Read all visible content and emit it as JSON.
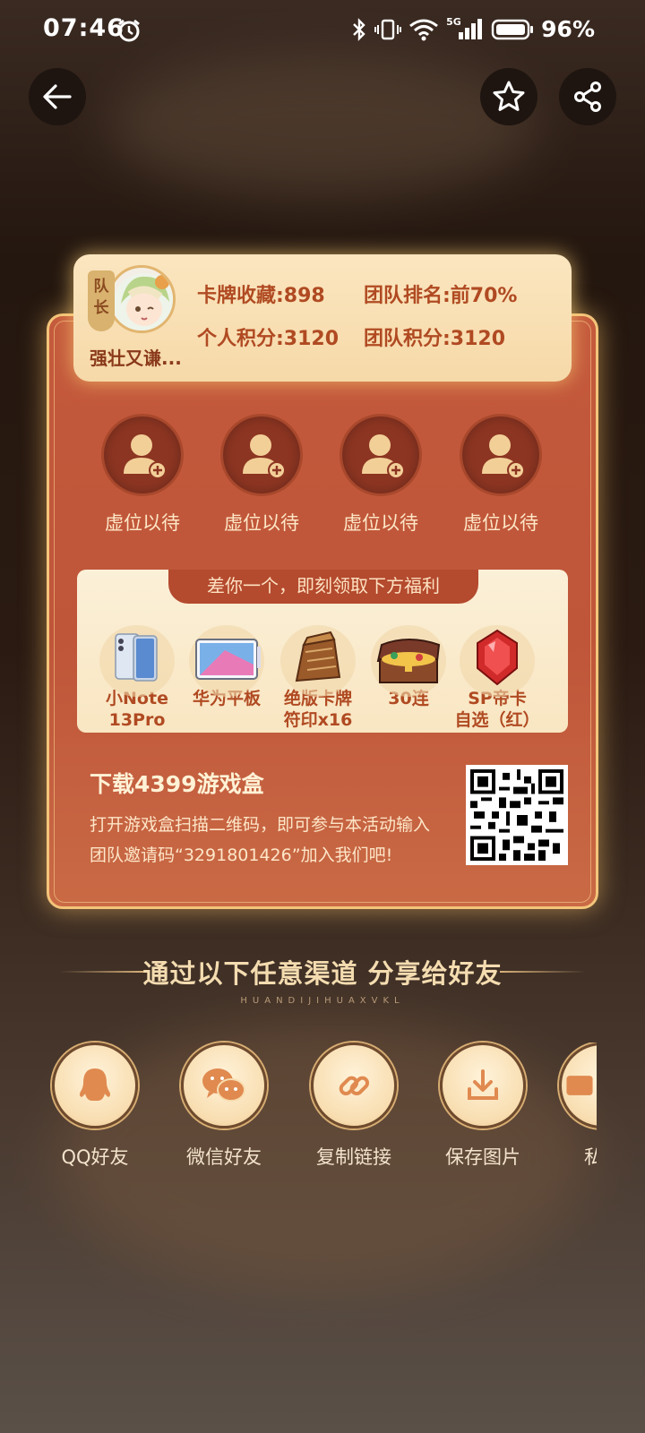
{
  "status_bar": {
    "time": "07:46",
    "network": "5G",
    "battery": "96%"
  },
  "card": {
    "captain_tag": "队长",
    "captain_name": "强壮又谦...",
    "stats": {
      "cards": "卡牌收藏:898",
      "team_rank": "团队排名:前70%",
      "personal_points": "个人积分:3120",
      "team_points": "团队积分:3120"
    },
    "slots": [
      {
        "label": "虚位以待"
      },
      {
        "label": "虚位以待"
      },
      {
        "label": "虚位以待"
      },
      {
        "label": "虚位以待"
      }
    ],
    "rewards_banner": "差你一个，即刻领取下方福利",
    "rewards": [
      {
        "label": "小Note\n13Pro",
        "icon": "phone-icon"
      },
      {
        "label": "华为平板",
        "icon": "tablet-icon"
      },
      {
        "label": "绝版卡牌\n符印x16",
        "icon": "card-pack-icon"
      },
      {
        "label": "30连",
        "icon": "treasure-chest-icon"
      },
      {
        "label": "SP帝卡\n自选（红）",
        "icon": "red-gem-icon"
      }
    ],
    "download_title": "下载4399游戏盒",
    "download_desc": "打开游戏盒扫描二维码，即可参与本活动输入团队邀请码“3291801426”加入我们吧!"
  },
  "share": {
    "title": "通过以下任意渠道  分享给好友",
    "subtitle": "HUANDIJIHUAXVKL",
    "items": [
      {
        "label": "QQ好友",
        "icon": "qq-icon"
      },
      {
        "label": "微信好友",
        "icon": "wechat-icon"
      },
      {
        "label": "复制链接",
        "icon": "link-icon"
      },
      {
        "label": "保存图片",
        "icon": "download-icon"
      },
      {
        "label": "私",
        "icon": "message-icon"
      }
    ]
  },
  "colors": {
    "accent": "#c45a3c",
    "gold": "#f3c47a",
    "text_dark": "#b04a22"
  }
}
